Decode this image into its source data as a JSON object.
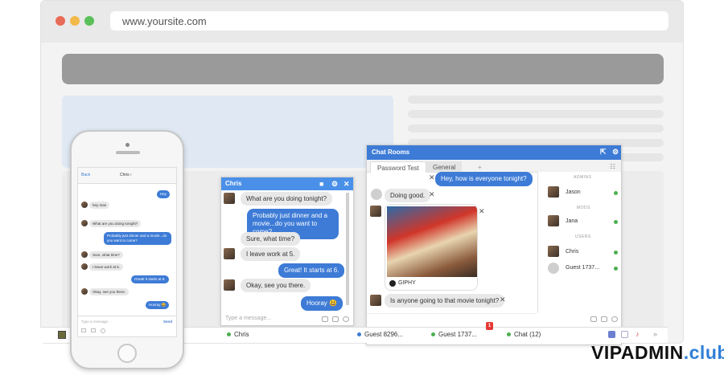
{
  "browser": {
    "url": "www.yoursite.com",
    "dots": [
      "#e86b57",
      "#f2b94a",
      "#5cc05a"
    ]
  },
  "rooms": {
    "title": "Chat Rooms",
    "tabs": [
      "Password Test",
      "General",
      "+"
    ],
    "messages": [
      {
        "text": "Hey, how is everyone tonight?"
      },
      {
        "text": "Doing good."
      },
      {
        "text": "Is anyone going to that movie tonight?"
      }
    ],
    "giphy": "GIPHY",
    "input_placeholder": "",
    "sections": {
      "admins": "ADMINS",
      "mods": "MODS",
      "users": "USERS"
    },
    "users": [
      "Jason",
      "Jana",
      "Chris",
      "Guest 1737..."
    ]
  },
  "chris": {
    "title": "Chris",
    "messages": [
      "What are you doing tonight?",
      "Probably just dinner and a movie...do you want to come?",
      "Sure, what time?",
      "I leave work at 5.",
      "Great! It starts at 6.",
      "Okay, see you there.",
      "Hooray 😃"
    ],
    "input_placeholder": "Type a message..."
  },
  "taskbar": {
    "items": [
      {
        "label": "Chris",
        "online": true
      },
      {
        "label": "Guest 8296...",
        "online": false
      },
      {
        "label": "Guest 1737...",
        "online": true
      },
      {
        "label": "Chat (12)",
        "online": true
      }
    ],
    "badge": "1"
  },
  "phone": {
    "back": "Back",
    "contact": "Chris ›",
    "messages": [
      "Hey",
      "hey man",
      "What are you doing tonight?",
      "Probably just dinner and a movie...do you want to come?",
      "Sure, what time?",
      "I leave work at 5.",
      "Great! It starts at 6.",
      "Okay, see you there.",
      "Hooray 😃"
    ],
    "input_placeholder": "Type a message...",
    "send": "Send"
  },
  "brand": {
    "main": "VIPADMIN",
    "suffix": ".club"
  }
}
